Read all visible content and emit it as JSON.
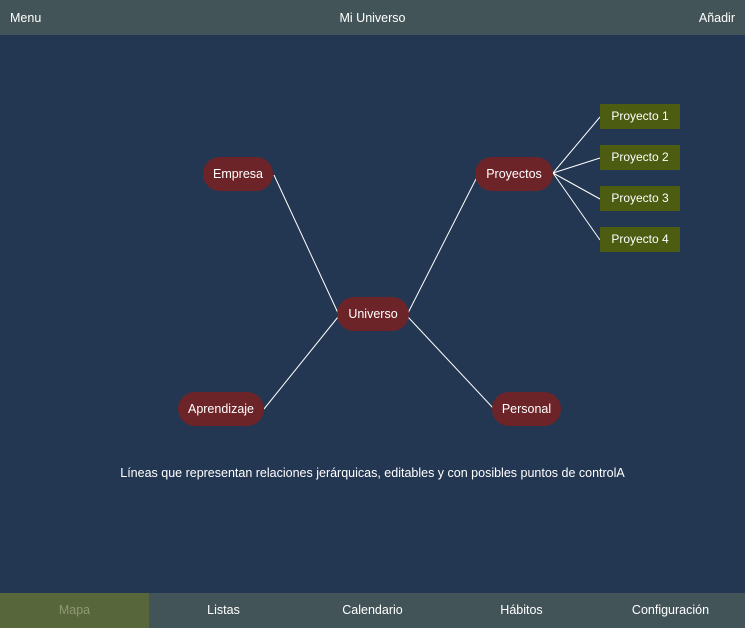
{
  "header": {
    "menu_label": "Menu",
    "title": "Mi Universo",
    "add_label": "Añadir"
  },
  "map": {
    "center": "Universo",
    "nodes": {
      "empresa": "Empresa",
      "proyectos": "Proyectos",
      "aprendizaje": "Aprendizaje",
      "personal": "Personal"
    },
    "projects": [
      "Proyecto 1",
      "Proyecto 2",
      "Proyecto 3",
      "Proyecto 4"
    ],
    "caption": "Líneas que representan relaciones jerárquicas, editables y con posibles puntos de controlA"
  },
  "tabs": {
    "items": [
      {
        "label": "Mapa",
        "active": true
      },
      {
        "label": "Listas",
        "active": false
      },
      {
        "label": "Calendario",
        "active": false
      },
      {
        "label": "Hábitos",
        "active": false
      },
      {
        "label": "Configuración",
        "active": false
      }
    ]
  },
  "colors": {
    "background": "#243752",
    "bar": "#435458",
    "node": "#6d2428",
    "project": "#4c5c10",
    "active_tab": "#58663c"
  }
}
